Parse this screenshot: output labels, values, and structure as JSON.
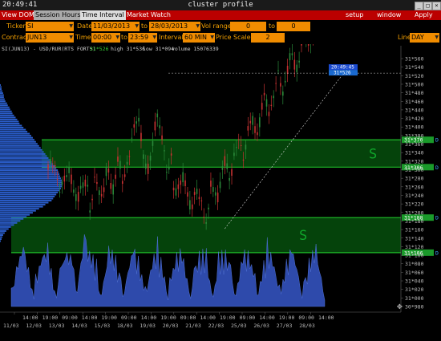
{
  "window": {
    "clock": "20:49:41",
    "title": "cluster profile"
  },
  "tabs": [
    "View DOM",
    "Session Hours",
    "Time Interval"
  ],
  "tab_active": "Time Interval",
  "menu_left": "Market Watch",
  "menu_right": [
    "setup",
    "window",
    "Apply"
  ],
  "controls": {
    "ticker_label": "Ticker",
    "ticker": "SI",
    "date_label": "Date",
    "date_from": "11/03/2013",
    "to_label": "to",
    "date_to": "28/03/2013",
    "volrange_label": "Vol range",
    "vol_min": "0",
    "vol_to_label": "to",
    "vol_max": "0",
    "contract_label": "Contract",
    "contract": "JUN13",
    "time_label": "Time",
    "time_from": "00:00",
    "time_to_label": "to",
    "time_to": "23:59",
    "interval_label": "Interval",
    "interval": "60 MIN",
    "pricescale_label": "Price Scale",
    "price_scale": "2",
    "line_label": "Line",
    "line": "DAY"
  },
  "chart_info": {
    "symbol": "SI(JUN13) - USD/RUR(RTS FORTS)",
    "last": "31*526",
    "high": "high 31*536",
    "low": "low 31*094",
    "volume": "volume 15076339"
  },
  "chart_data": {
    "type": "candlestick-cluster",
    "y_ticks": [
      "31*560",
      "31*540",
      "31*520",
      "31*500",
      "31*480",
      "31*460",
      "31*440",
      "31*420",
      "31*400",
      "31*380",
      "31*360",
      "31*340",
      "31*320",
      "31*300",
      "31*280",
      "31*260",
      "31*240",
      "31*220",
      "31*200",
      "31*180",
      "31*160",
      "31*140",
      "31*120",
      "31*100",
      "31*080",
      "31*060",
      "31*040",
      "31*020",
      "31*000",
      "30*980"
    ],
    "ylim": [
      30980,
      31560
    ],
    "x_top_labels": [
      "14:00",
      "19:00",
      "09:00",
      "14:00",
      "19:00",
      "09:00",
      "14:00",
      "19:00",
      "09:00",
      "14:00",
      "19:00",
      "09:00",
      "14:00",
      "19:00",
      "09:00",
      "14:00"
    ],
    "x_dates": [
      "11/03",
      "12/03",
      "13/03",
      "14/03",
      "15/03",
      "18/03",
      "19/03",
      "20/03",
      "21/03",
      "22/03",
      "25/03",
      "26/03",
      "27/03",
      "28/03"
    ],
    "current_price": {
      "time": "20:49:45",
      "price": "31*526"
    },
    "zones": [
      {
        "label": "S",
        "top": 31370,
        "bottom": 31306,
        "top_label": "31*370",
        "bottom_label": "31*306",
        "color": "#0a7a14"
      },
      {
        "label": "S",
        "top": 31188,
        "bottom": 31106,
        "top_label": "31*188",
        "bottom_label": "31*106",
        "color": "#0a7a14"
      }
    ],
    "trendline": {
      "from": {
        "bar": 0.548,
        "price": 31162
      },
      "to": {
        "bar": 0.853,
        "price": 31526
      }
    },
    "high_line_price": 31526,
    "volume_profile": [
      1,
      2,
      2,
      3,
      4,
      5,
      5,
      6,
      7,
      9,
      10,
      12,
      13,
      15,
      16,
      18,
      20,
      22,
      24,
      25,
      28,
      30,
      33,
      35,
      38,
      40,
      42,
      44,
      46,
      48,
      50,
      52,
      54,
      56,
      58,
      60,
      62,
      64,
      66,
      68,
      70,
      72,
      74,
      75,
      76,
      77,
      78,
      79,
      80,
      80,
      79,
      78,
      76,
      74,
      72,
      70,
      68,
      66,
      62,
      58,
      55,
      50,
      46,
      42,
      38,
      34,
      30,
      26,
      22,
      18,
      14,
      11,
      8,
      6,
      4,
      3,
      2,
      1
    ],
    "volume_colors": {
      "profile": "#2a5cc8",
      "histogram": "#3657c9"
    },
    "candle_colors": {
      "up": "#c83232",
      "down": "#2a8a3a"
    }
  }
}
